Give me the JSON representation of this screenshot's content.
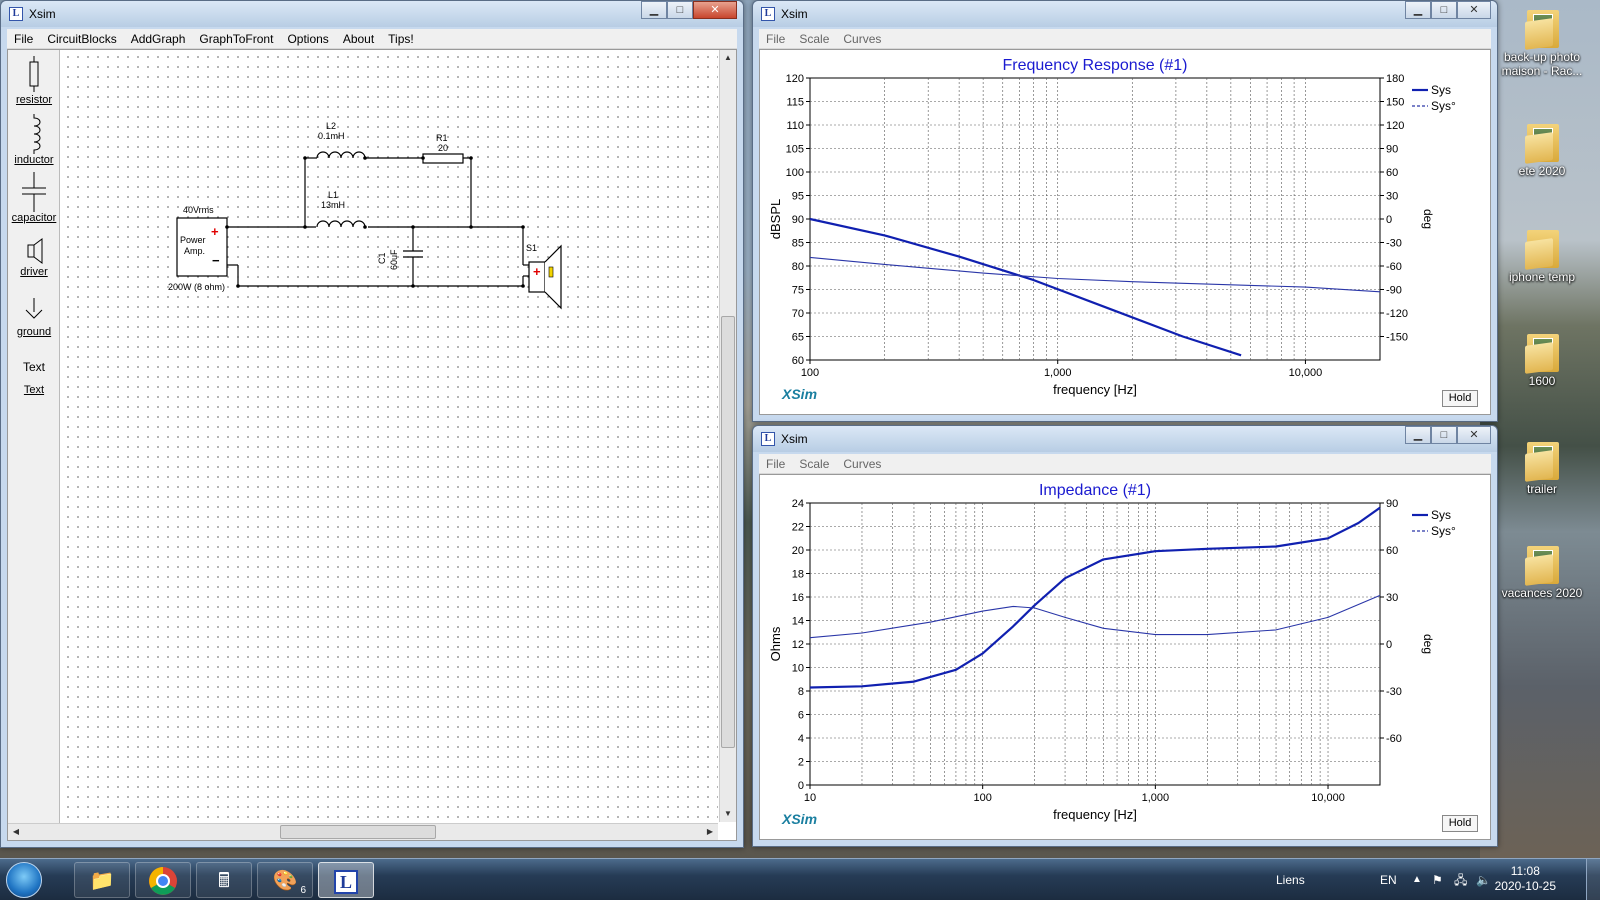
{
  "circuit_window": {
    "title": "Xsim",
    "menu": [
      "File",
      "CircuitBlocks",
      "AddGraph",
      "GraphToFront",
      "Options",
      "About",
      "Tips!"
    ],
    "palette": [
      {
        "label": "resistor",
        "icon": "resistor-icon"
      },
      {
        "label": "inductor",
        "icon": "inductor-icon"
      },
      {
        "label": "capacitor",
        "icon": "capacitor-icon"
      },
      {
        "label": "driver",
        "icon": "driver-icon"
      },
      {
        "label": "ground",
        "icon": "ground-icon"
      },
      {
        "label": "Text",
        "icon": "text-icon",
        "glyph": "Text"
      }
    ],
    "schematic": {
      "amp_label_top": "40Vrms",
      "amp_name_1": "Power",
      "amp_name_2": "Amp.",
      "amp_label_bottom": "200W (8 ohm)",
      "plus": "+",
      "minus": "−",
      "l2_name": "L2",
      "l2_value": "0.1mH",
      "r1_name": "R1",
      "r1_value": "20",
      "l1_name": "L1",
      "l1_value": "13mH",
      "c1_name": "C1",
      "c1_value": "60uF",
      "s1_name": "S1"
    }
  },
  "freq_window": {
    "title": "Xsim",
    "menu": [
      "File",
      "Scale",
      "Curves"
    ],
    "logo": "XSim",
    "hold": "Hold"
  },
  "imp_window": {
    "title": "Xsim",
    "menu": [
      "File",
      "Scale",
      "Curves"
    ],
    "logo": "XSim",
    "hold": "Hold"
  },
  "chart_data": [
    {
      "type": "line",
      "title": "Frequency Response (#1)",
      "xlabel": "frequency [Hz]",
      "ylabel": "dBSPL",
      "y2label": "deg",
      "xscale": "log",
      "xlim": [
        100,
        20000
      ],
      "ylim": [
        60,
        120
      ],
      "y2lim": [
        -180,
        180
      ],
      "x_ticklabels": [
        "100",
        "1,000",
        "10,000"
      ],
      "y_ticks": [
        60,
        65,
        70,
        75,
        80,
        85,
        90,
        95,
        100,
        105,
        110,
        115,
        120
      ],
      "y2_ticks": [
        -150,
        -120,
        -90,
        -60,
        -30,
        0,
        30,
        60,
        90,
        120,
        150,
        180
      ],
      "legend": "top-right",
      "series": [
        {
          "name": "Sys",
          "axis": "left",
          "style": "solid",
          "color": "#1020b0",
          "x": [
            100,
            200,
            400,
            800,
            1600,
            3200,
            5500
          ],
          "y": [
            90,
            86.5,
            82,
            77,
            71,
            65,
            61
          ]
        },
        {
          "name": "Sys°",
          "axis": "right",
          "style": "solid-thin",
          "color": "#2a36a8",
          "x": [
            100,
            200,
            500,
            1000,
            2000,
            5000,
            10000,
            20000
          ],
          "y": [
            -49,
            -58,
            -69,
            -76,
            -80,
            -84,
            -87,
            -93
          ]
        }
      ]
    },
    {
      "type": "line",
      "title": "Impedance (#1)",
      "xlabel": "frequency [Hz]",
      "ylabel": "Ohms",
      "y2label": "deg",
      "xscale": "log",
      "xlim": [
        10,
        20000
      ],
      "ylim": [
        0,
        24
      ],
      "y2lim": [
        -90,
        90
      ],
      "x_ticklabels": [
        "10",
        "100",
        "1,000",
        "10,000"
      ],
      "y_ticks": [
        0,
        2,
        4,
        6,
        8,
        10,
        12,
        14,
        16,
        18,
        20,
        22,
        24
      ],
      "y2_ticks": [
        -60,
        -30,
        0,
        30,
        60,
        90
      ],
      "legend": "top-right",
      "series": [
        {
          "name": "Sys",
          "axis": "left",
          "style": "solid",
          "color": "#1020b0",
          "x": [
            10,
            20,
            40,
            70,
            100,
            150,
            200,
            300,
            500,
            1000,
            2000,
            5000,
            10000,
            15000,
            20000
          ],
          "y": [
            8.3,
            8.4,
            8.8,
            9.8,
            11.2,
            13.5,
            15.3,
            17.6,
            19.2,
            19.9,
            20.1,
            20.3,
            21.0,
            22.3,
            23.6
          ]
        },
        {
          "name": "Sys°",
          "axis": "right",
          "style": "solid-thin",
          "color": "#2a36a8",
          "x": [
            10,
            20,
            50,
            100,
            150,
            200,
            300,
            500,
            1000,
            2000,
            5000,
            10000,
            20000
          ],
          "y": [
            4,
            7,
            14,
            21,
            24,
            23,
            17,
            10,
            6,
            6,
            9,
            17,
            31
          ]
        }
      ]
    }
  ],
  "desktop_icons": [
    {
      "label": "back-up photo maison - Rac..."
    },
    {
      "label": "ete 2020"
    },
    {
      "label": "iphone temp"
    },
    {
      "label": "1600"
    },
    {
      "label": "trailer"
    },
    {
      "label": "vacances 2020"
    }
  ],
  "taskbar": {
    "apps": [
      {
        "name": "windows-explorer",
        "icon": "folder-icon"
      },
      {
        "name": "chrome",
        "icon": "chrome-icon"
      },
      {
        "name": "calculator",
        "icon": "calculator-icon"
      },
      {
        "name": "paint",
        "icon": "paint-icon",
        "badge": "6"
      },
      {
        "name": "xsim",
        "icon": "xsim-icon",
        "active": true
      }
    ],
    "links_label": "Liens",
    "lang": "EN",
    "time": "11:08",
    "date": "2020-10-25"
  }
}
